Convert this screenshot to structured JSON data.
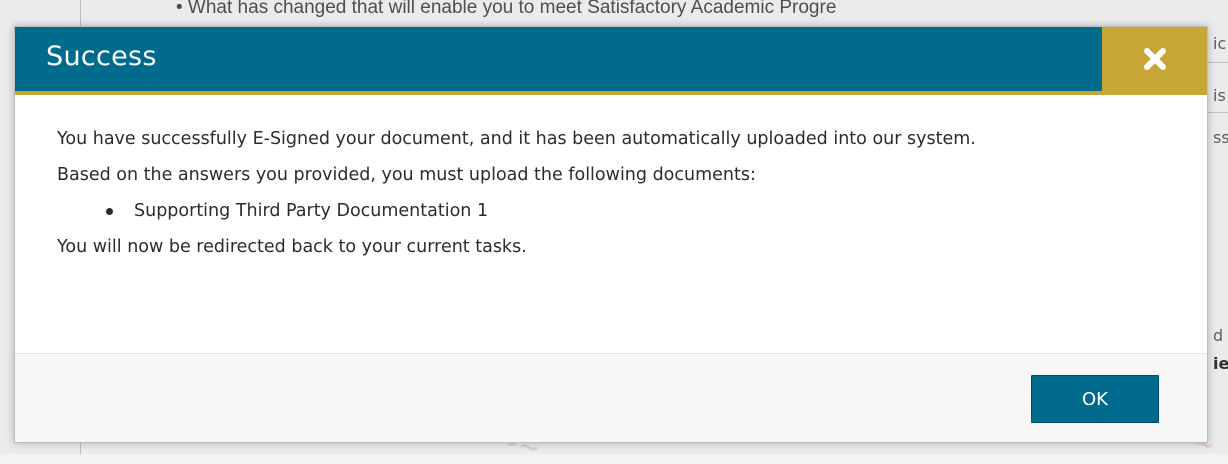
{
  "background": {
    "top_line": "• What has changed that will enable you to meet Satisfactory Academic Progre",
    "right_fragments": [
      {
        "text": "ic",
        "top": 0
      },
      {
        "text": "is",
        "top": 0
      },
      {
        "text": "ss",
        "top": 0
      },
      {
        "text": "d",
        "top": 0
      },
      {
        "text": "ie",
        "top": 0
      }
    ]
  },
  "modal": {
    "title": "Success",
    "close_icon": "close-x-icon",
    "body": {
      "paragraph_1": "You have successfully E-Signed your document, and it has been automatically uploaded into our system.",
      "paragraph_2": "Based on the answers you provided, you must upload the following documents:",
      "documents": [
        "Supporting Third Party Documentation 1"
      ],
      "paragraph_3": "You will now be redirected back to your current tasks."
    },
    "ok_label": "OK"
  },
  "colors": {
    "header": "#006b8d",
    "accent": "#c8a636",
    "button": "#006b8d"
  }
}
